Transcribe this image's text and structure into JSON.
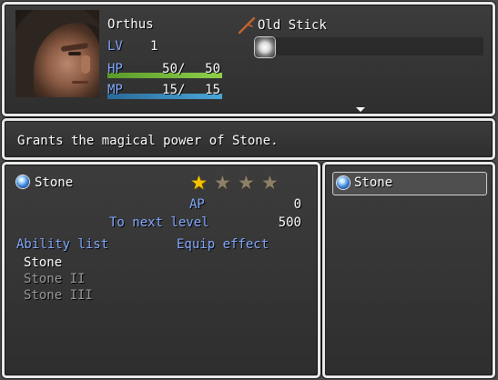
{
  "actor": {
    "name": "Orthus",
    "level_label": "LV",
    "level": "1",
    "hp_label": "HP",
    "hp_current": "50",
    "hp_max": "50",
    "mp_label": "MP",
    "mp_current": "15",
    "mp_max": "15",
    "hp_fraction": 1.0,
    "mp_fraction": 1.0,
    "hp_color": "#8fcf4a",
    "mp_color": "#4aa6d8"
  },
  "equipment": {
    "weapon_name": "Old Stick",
    "weapon_icon": "stick-icon",
    "accessory_icon": "orb-gem-icon"
  },
  "help": {
    "text": "Grants the magical power of Stone."
  },
  "stone": {
    "name": "Stone",
    "icon": "blue-orb-icon",
    "stars_total": 4,
    "stars_filled": 1,
    "ap_label": "AP",
    "ap_value": "0",
    "next_label": "To next level",
    "next_value": "500",
    "ability_header": "Ability list",
    "equip_header": "Equip effect",
    "abilities": [
      "Stone",
      "Stone II",
      "Stone III"
    ]
  },
  "list": {
    "items": [
      {
        "label": "Stone",
        "icon": "blue-orb-icon",
        "selected": true
      }
    ]
  },
  "colors": {
    "system_text": "#84aaff",
    "disabled_text": "#9a9a9a",
    "star_on": "#f5c400",
    "star_off": "#8c8168"
  }
}
